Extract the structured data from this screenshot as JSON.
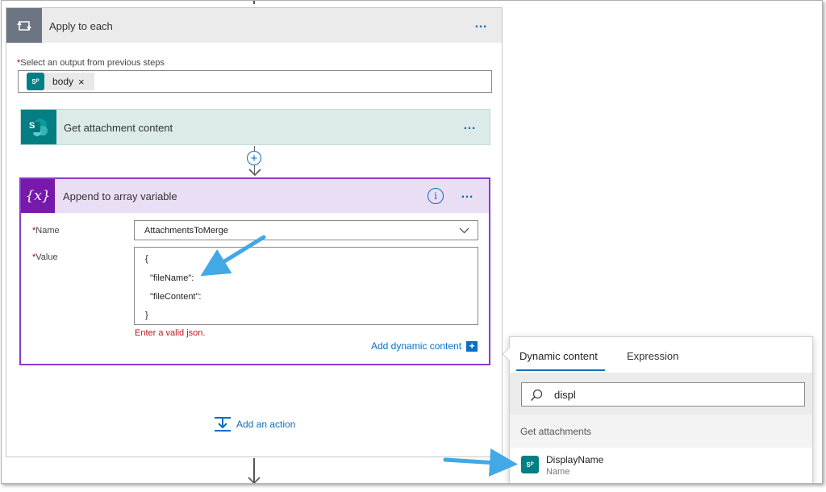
{
  "apply_each": {
    "title": "Apply to each",
    "more": "…",
    "select_label": "Select an output from previous steps",
    "required_mark": "*",
    "token_label": "body",
    "token_remove": "×"
  },
  "get_attachment": {
    "title": "Get attachment content",
    "more": "…",
    "icon_letter": "S"
  },
  "insert_step": "+",
  "append": {
    "title": "Append to array variable",
    "icon_text": "{x}",
    "info": "i",
    "more": "…",
    "name_label": "Name",
    "name_value": "AttachmentsToMerge",
    "value_label": "Value",
    "value_lines": [
      "{",
      "\"fileName\":",
      "\"fileContent\":",
      "}"
    ],
    "error": "Enter a valid json.",
    "add_dynamic": "Add dynamic content",
    "add_dynamic_icon": "+"
  },
  "add_action": "Add an action",
  "dynamic_panel": {
    "tab_dynamic": "Dynamic content",
    "tab_expression": "Expression",
    "search_value": "displ",
    "section": "Get attachments",
    "item_name": "DisplayName",
    "item_sub": "Name",
    "item_icon_letter": "S"
  },
  "colors": {
    "accent": "#0a6fc2",
    "purple": "#7719aa",
    "sharepoint": "#037f84",
    "annotation": "#42a8e6"
  }
}
